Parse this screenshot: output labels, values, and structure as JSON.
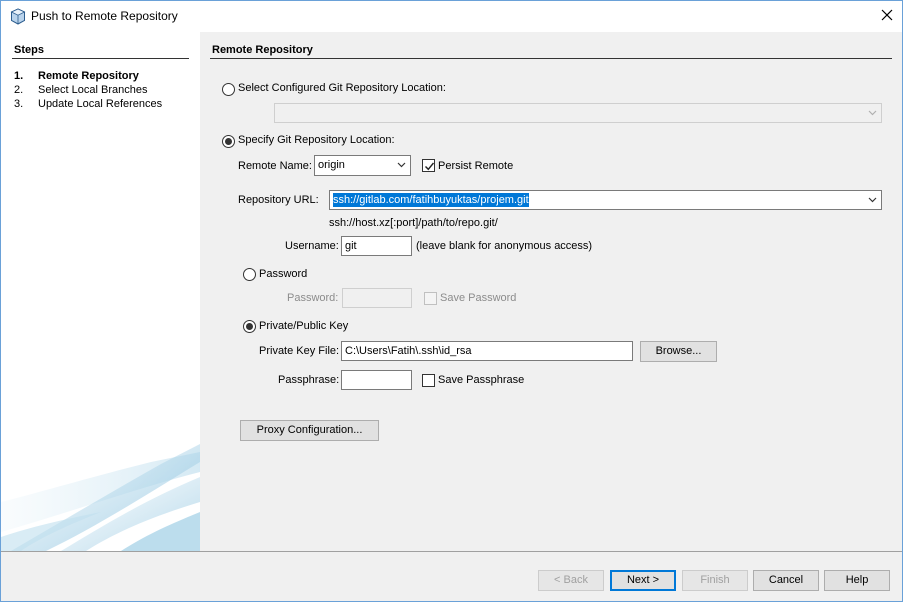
{
  "window": {
    "title": "Push to Remote Repository"
  },
  "steps": {
    "title": "Steps",
    "items": [
      {
        "num": "1.",
        "label": "Remote Repository",
        "active": true
      },
      {
        "num": "2.",
        "label": "Select Local Branches",
        "active": false
      },
      {
        "num": "3.",
        "label": "Update Local References",
        "active": false
      }
    ]
  },
  "panel": {
    "title": "Remote Repository",
    "configured_label": "Select Configured Git Repository Location:",
    "configured_value": "",
    "specify_label": "Specify Git Repository Location:",
    "remote_name_label": "Remote Name:",
    "remote_name_value": "origin",
    "persist_remote_label": "Persist Remote",
    "persist_remote_checked": true,
    "repo_url_label": "Repository URL:",
    "repo_url_value": "ssh://gitlab.com/fatihbuyuktas/projem.git",
    "repo_url_hint": "ssh://host.xz[:port]/path/to/repo.git/",
    "username_label": "Username:",
    "username_value": "git",
    "username_hint": "(leave blank for anonymous access)",
    "password_option_label": "Password",
    "password_label": "Password:",
    "password_value": "",
    "save_password_label": "Save Password",
    "private_key_option_label": "Private/Public Key",
    "private_key_file_label": "Private Key File:",
    "private_key_file_value": "C:\\Users\\Fatih\\.ssh\\id_rsa",
    "browse_label": "Browse...",
    "passphrase_label": "Passphrase:",
    "passphrase_value": "",
    "save_passphrase_label": "Save Passphrase",
    "proxy_label": "Proxy Configuration..."
  },
  "footer": {
    "back_label": "< Back",
    "next_label": "Next >",
    "finish_label": "Finish",
    "cancel_label": "Cancel",
    "help_label": "Help"
  },
  "colors": {
    "accent": "#0078d7",
    "selection": "#0078d7",
    "border": "#7a7a7a"
  }
}
